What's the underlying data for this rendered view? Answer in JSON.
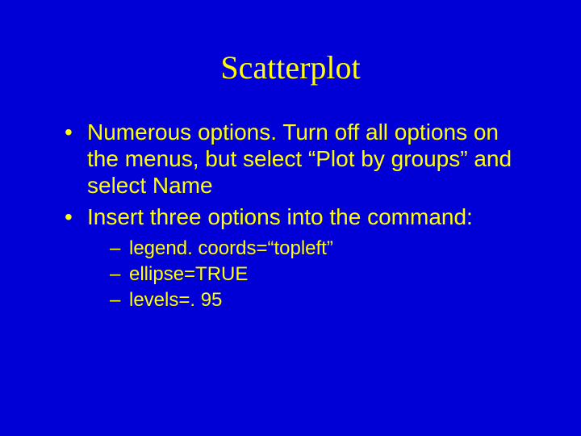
{
  "title": "Scatterplot",
  "bullets": [
    "Numerous options. Turn off all options on the menus, but select “Plot by groups” and select Name",
    "Insert three options into the command:"
  ],
  "subbullets": [
    "legend. coords=“topleft”",
    "ellipse=TRUE",
    "levels=. 95"
  ]
}
